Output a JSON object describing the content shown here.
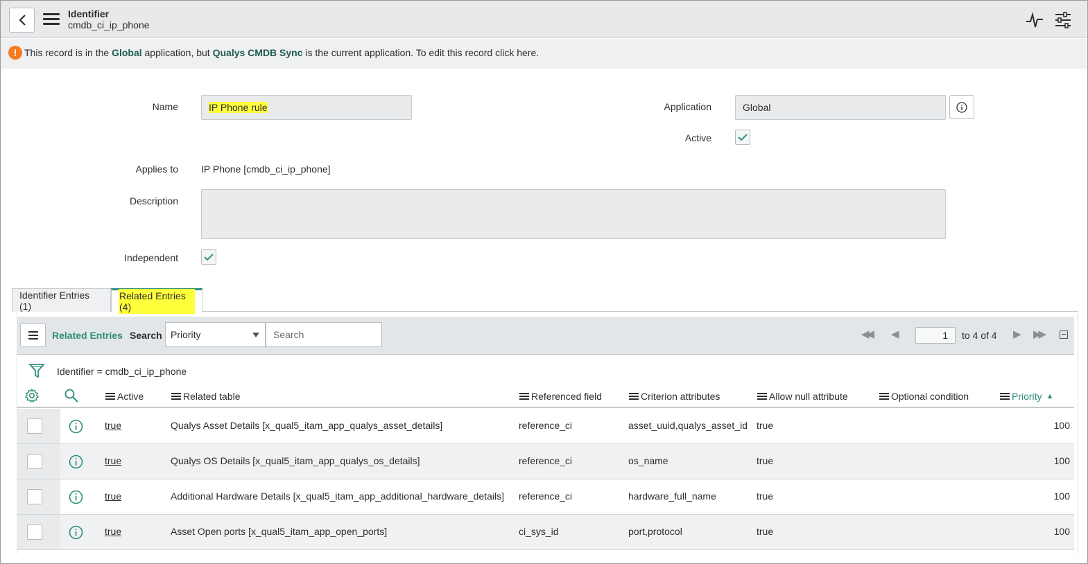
{
  "header": {
    "title": "Identifier",
    "subtitle": "cmdb_ci_ip_phone"
  },
  "notice": {
    "prefix": "This record is in the ",
    "app1": "Global",
    "mid": " application, but ",
    "app2": "Qualys CMDB Sync",
    "suffix": " is the current application. To edit this record ",
    "link": "click here."
  },
  "form": {
    "name_label": "Name",
    "name_value": "IP Phone rule",
    "application_label": "Application",
    "application_value": "Global",
    "active_label": "Active",
    "applies_to_label": "Applies to",
    "applies_to_value": "IP Phone [cmdb_ci_ip_phone]",
    "description_label": "Description",
    "description_value": "",
    "independent_label": "Independent"
  },
  "tabs": [
    {
      "label": "Identifier Entries (1)",
      "active": false
    },
    {
      "label": "Related Entries (4)",
      "active": true
    }
  ],
  "list": {
    "title": "Related Entries",
    "search_label": "Search",
    "search_field": "Priority",
    "search_placeholder": "Search",
    "page_value": "1",
    "page_text": "to 4 of 4",
    "filter": "Identifier = cmdb_ci_ip_phone",
    "columns": [
      "Active",
      "Related table",
      "Referenced field",
      "Criterion attributes",
      "Allow null attribute",
      "Optional condition",
      "Priority"
    ],
    "sort_indicator": "▲",
    "rows": [
      {
        "active": "true",
        "related_table": "Qualys Asset Details [x_qual5_itam_app_qualys_asset_details]",
        "referenced_field": "reference_ci",
        "criterion": "asset_uuid,qualys_asset_id",
        "allow_null": "true",
        "optional": "",
        "priority": "100"
      },
      {
        "active": "true",
        "related_table": "Qualys OS Details [x_qual5_itam_app_qualys_os_details]",
        "referenced_field": "reference_ci",
        "criterion": "os_name",
        "allow_null": "true",
        "optional": "",
        "priority": "100"
      },
      {
        "active": "true",
        "related_table": "Additional Hardware Details [x_qual5_itam_app_additional_hardware_details]",
        "referenced_field": "reference_ci",
        "criterion": "hardware_full_name",
        "allow_null": "true",
        "optional": "",
        "priority": "100"
      },
      {
        "active": "true",
        "related_table": "Asset Open ports [x_qual5_itam_app_open_ports]",
        "referenced_field": "ci_sys_id",
        "criterion": "port,protocol",
        "allow_null": "true",
        "optional": "",
        "priority": "100"
      }
    ]
  },
  "colors": {
    "accent": "#2e8f7a",
    "highlight": "#ffff3c",
    "warning": "#f47b20"
  }
}
